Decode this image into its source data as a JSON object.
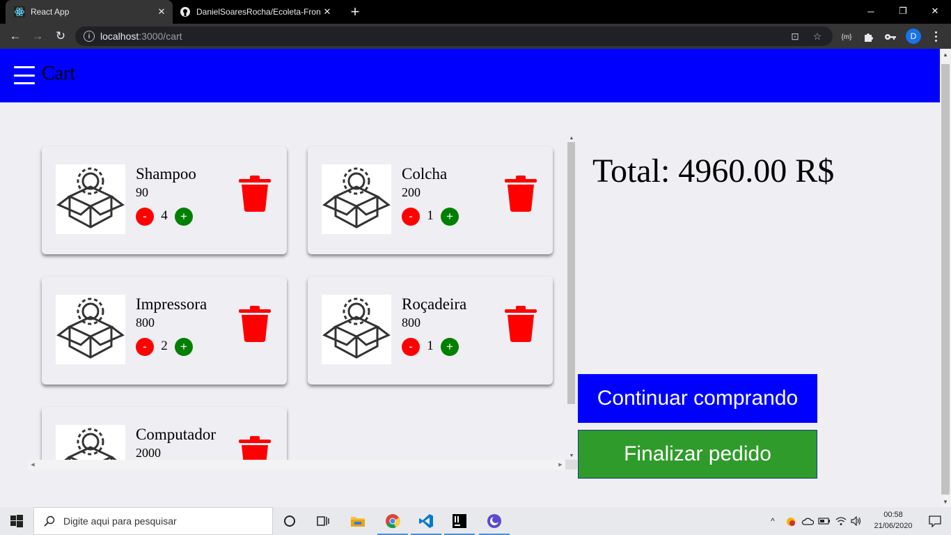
{
  "browser": {
    "tabs": [
      {
        "title": "React App",
        "icon": "react-icon",
        "active": true
      },
      {
        "title": "DanielSoaresRocha/Ecoleta-Front",
        "icon": "github-icon",
        "active": false
      }
    ],
    "address": {
      "host": "localhost",
      "path": ":3000/cart"
    },
    "profile_initial": "D",
    "ext_label": "{m}"
  },
  "app": {
    "title": "Cart",
    "total_text": "Total: 4960.00 R$",
    "continue_label": "Continuar comprando",
    "finish_label": "Finalizar pedido",
    "items": [
      {
        "name": "Shampoo",
        "price": "90",
        "quantity": "4"
      },
      {
        "name": "Colcha",
        "price": "200",
        "quantity": "1"
      },
      {
        "name": "Impressora",
        "price": "800",
        "quantity": "2"
      },
      {
        "name": "Roçadeira",
        "price": "800",
        "quantity": "1"
      },
      {
        "name": "Computador",
        "price": "2000",
        "quantity": ""
      }
    ],
    "minus_label": "-",
    "plus_label": "+"
  },
  "taskbar": {
    "search_placeholder": "Digite aqui para pesquisar",
    "time": "00:58",
    "date": "21/06/2020"
  },
  "colors": {
    "appbar": "#0000ff",
    "minus": "#ff0000",
    "plus": "#008000",
    "trash": "#ff0000",
    "continue": "#0000ff",
    "finish": "#2f9b2a"
  }
}
